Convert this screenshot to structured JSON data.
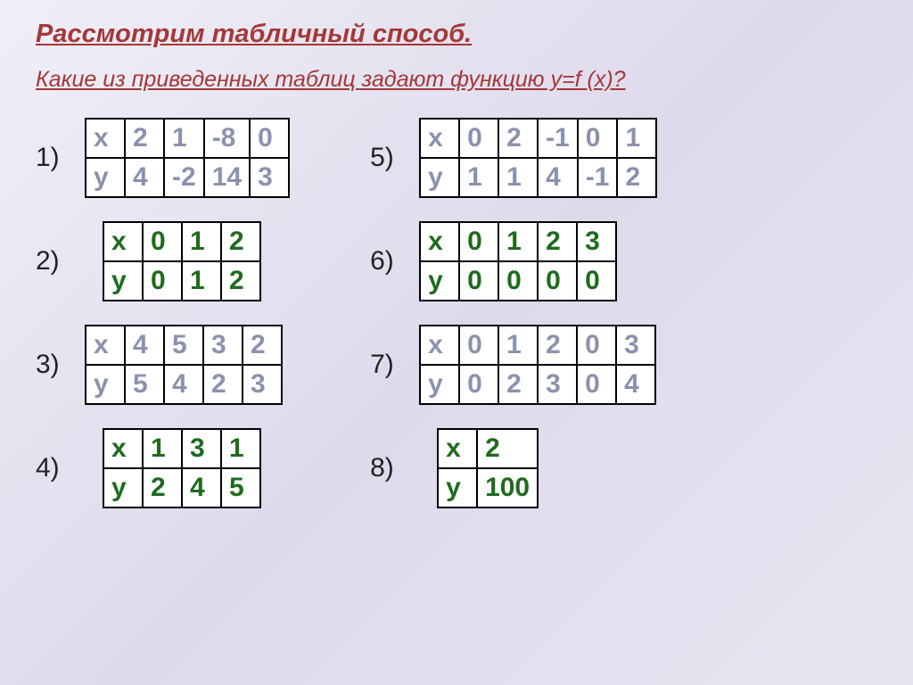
{
  "title": "Рассмотрим табличный способ.",
  "subtitle": "Какие из приведенных таблиц задают функцию y=f (x)?",
  "labels": {
    "x": "x",
    "y": "y"
  },
  "nums": {
    "n1": "1)",
    "n2": "2)",
    "n3": "3)",
    "n4": "4)",
    "n5": "5)",
    "n6": "6)",
    "n7": "7)",
    "n8": "8)"
  },
  "t1": {
    "x": [
      "2",
      "1",
      "-8",
      "0"
    ],
    "y": [
      "4",
      "-2",
      "14",
      "3"
    ]
  },
  "t2": {
    "x": [
      "0",
      "1",
      "2"
    ],
    "y": [
      "0",
      "1",
      "2"
    ]
  },
  "t3": {
    "x": [
      "4",
      "5",
      "3",
      "2"
    ],
    "y": [
      "5",
      "4",
      "2",
      "3"
    ]
  },
  "t4": {
    "x": [
      "1",
      "3",
      "1"
    ],
    "y": [
      "2",
      "4",
      "5"
    ]
  },
  "t5": {
    "x": [
      "0",
      "2",
      "-1",
      "0",
      "1"
    ],
    "y": [
      "1",
      "1",
      "4",
      "-1",
      "2"
    ]
  },
  "t6": {
    "x": [
      "0",
      "1",
      "2",
      "3"
    ],
    "y": [
      "0",
      "0",
      "0",
      "0"
    ]
  },
  "t7": {
    "x": [
      "0",
      "1",
      "2",
      "0",
      "3"
    ],
    "y": [
      "0",
      "2",
      "3",
      "0",
      "4"
    ]
  },
  "t8": {
    "x": [
      "2"
    ],
    "y": [
      "100"
    ]
  }
}
